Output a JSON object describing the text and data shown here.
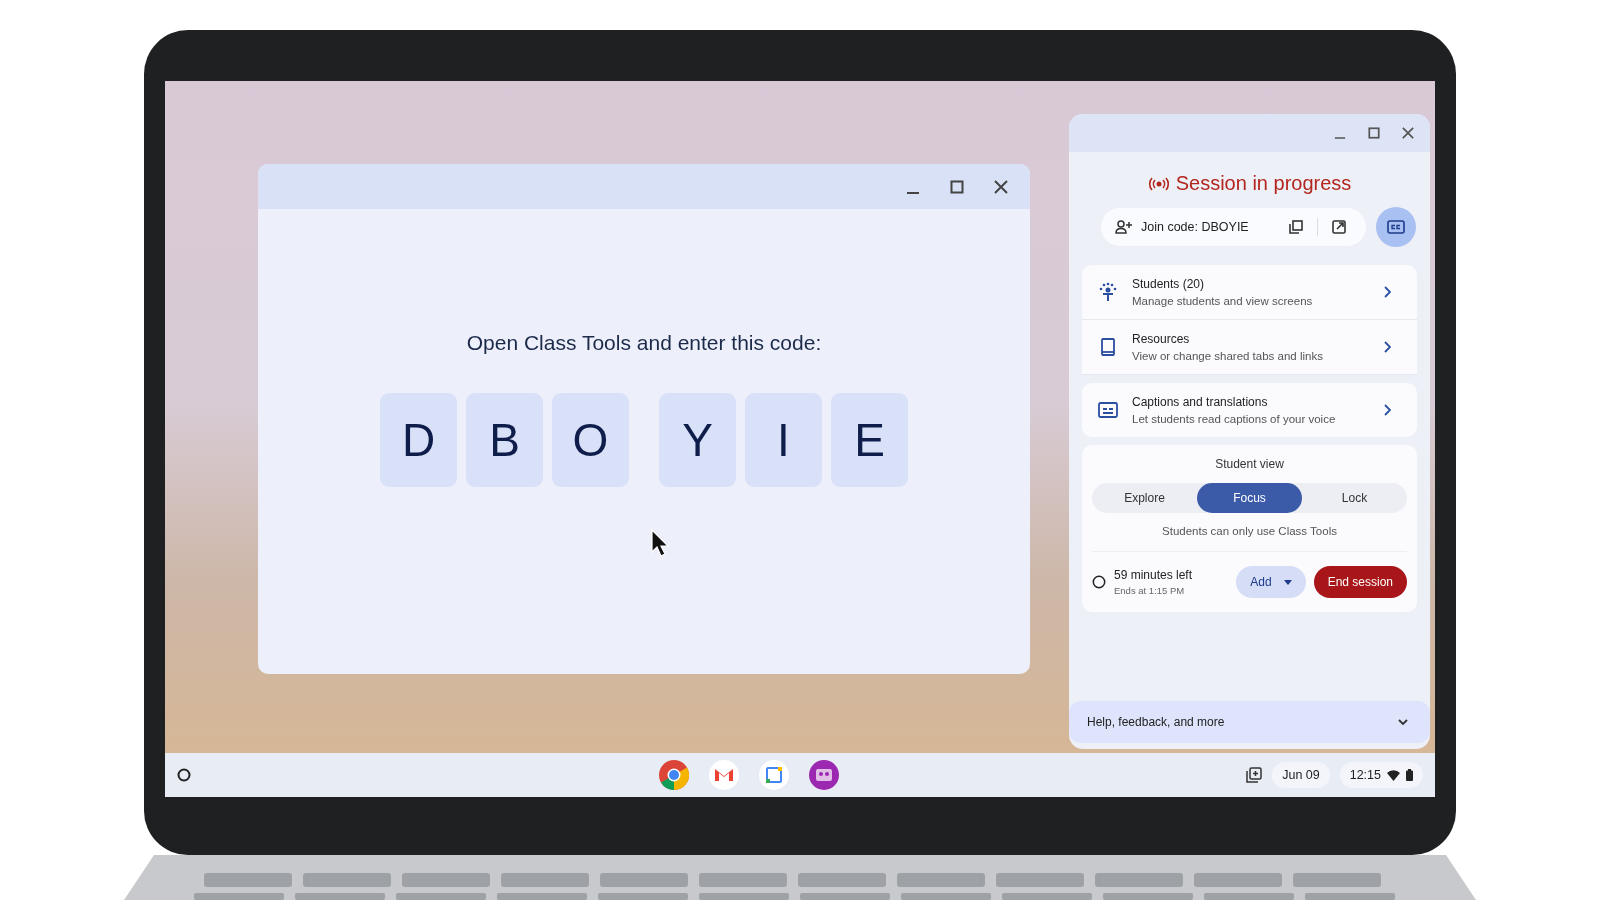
{
  "code_window": {
    "prompt": "Open Class Tools and enter this code:",
    "code_groups": [
      [
        "D",
        "B",
        "O"
      ],
      [
        "Y",
        "I",
        "E"
      ]
    ]
  },
  "panel": {
    "status": "Session in progress",
    "join_code": "Join code: DBOYIE",
    "captions_on": true,
    "items": [
      {
        "kind": "students",
        "title": "Students (20)",
        "subtitle": "Manage students and view screens"
      },
      {
        "kind": "resources",
        "title": "Resources",
        "subtitle": "View or change shared tabs and links"
      },
      {
        "kind": "captions",
        "title": "Captions and translations",
        "subtitle": "Let students read captions of your voice"
      }
    ],
    "student_view": {
      "title": "Student view",
      "options": [
        {
          "label": "Explore",
          "selected": false
        },
        {
          "label": "Focus",
          "selected": true
        },
        {
          "label": "Lock",
          "selected": false
        }
      ],
      "note": "Students can only use Class Tools"
    },
    "timer": {
      "remaining": "59 minutes left",
      "ends": "Ends at 1:15 PM",
      "add": "Add",
      "end": "End session"
    },
    "footer": "Help, feedback, and more"
  },
  "taskbar": {
    "date": "Jun 09",
    "time": "12:15"
  }
}
